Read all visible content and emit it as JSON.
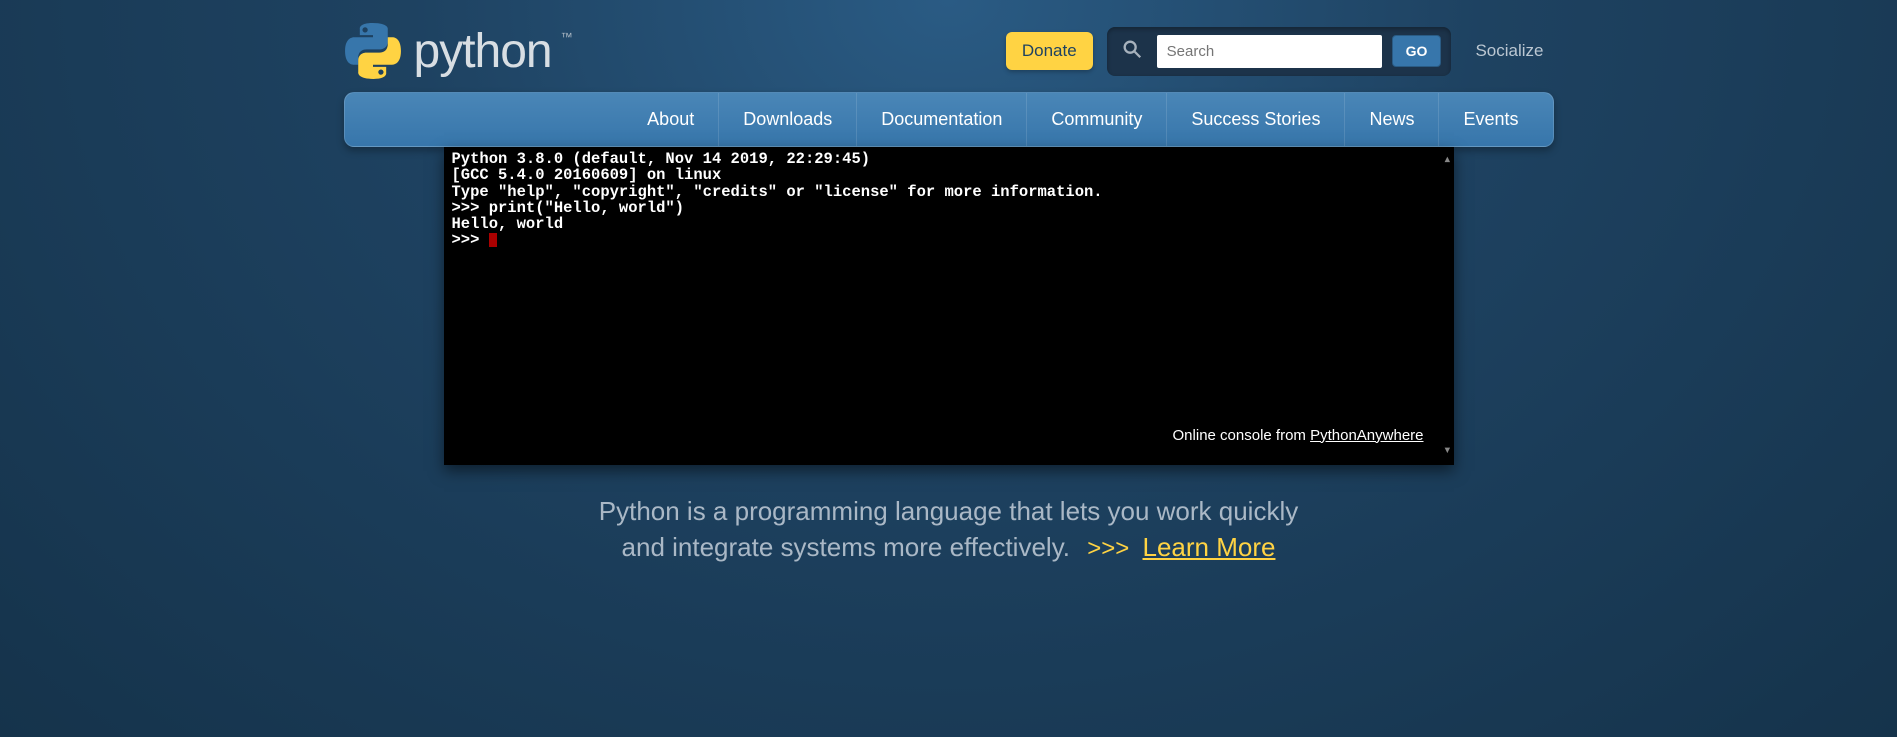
{
  "header": {
    "logo_text": "python",
    "logo_tm": "™",
    "donate_label": "Donate",
    "search_placeholder": "Search",
    "go_label": "GO",
    "socialize_label": "Socialize"
  },
  "nav": {
    "items": [
      {
        "label": "About"
      },
      {
        "label": "Downloads"
      },
      {
        "label": "Documentation"
      },
      {
        "label": "Community"
      },
      {
        "label": "Success Stories"
      },
      {
        "label": "News"
      },
      {
        "label": "Events"
      }
    ]
  },
  "console": {
    "lines": [
      "Python 3.8.0 (default, Nov 14 2019, 22:29:45)",
      "[GCC 5.4.0 20160609] on linux",
      "Type \"help\", \"copyright\", \"credits\" or \"license\" for more information.",
      ">>> print(\"Hello, world\")",
      "Hello, world",
      ">>> "
    ],
    "footer_prefix": "Online console from ",
    "footer_link": "PythonAnywhere"
  },
  "tagline": {
    "line1": "Python is a programming language that lets you work quickly",
    "line2_prefix": "and integrate systems more effectively. ",
    "chevrons": ">>>",
    "learn_more": "Learn More"
  }
}
